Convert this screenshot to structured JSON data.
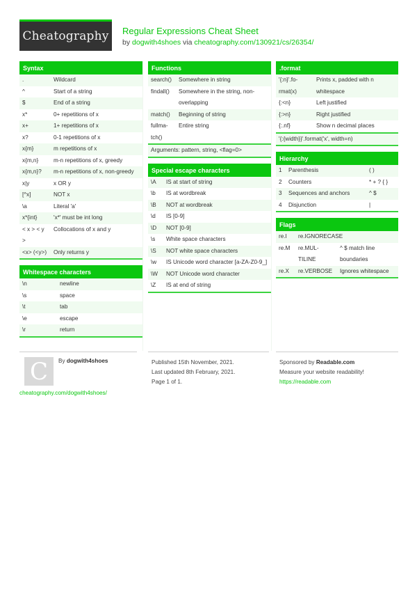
{
  "header": {
    "logo": "Cheatography",
    "title": "Regular Expressions Cheat Sheet",
    "by_prefix": "by",
    "author": "dogwith4shoes",
    "via": "via",
    "url": "cheatography.com/130921/cs/26354/"
  },
  "syntax": {
    "title": "Syntax",
    "rows": [
      [
        ".",
        "Wildcard"
      ],
      [
        "^",
        "Start of a string"
      ],
      [
        "$",
        "End of a string"
      ],
      [
        "x*",
        "0+ repetitions of x"
      ],
      [
        "x+",
        "1+ repetitions of x"
      ],
      [
        "x?",
        "0-1 repetitions of x"
      ],
      [
        "x{m}",
        "m repetitions of x"
      ],
      [
        "x{m,n}",
        "m-n repetitions of x, greedy"
      ],
      [
        "x{m,n}?",
        "m-n repetitions of x, non-greedy"
      ],
      [
        "x|y",
        "x OR y"
      ],
      [
        "[^x]",
        "NOT x"
      ],
      [
        "\\a",
        "Literal 'a'"
      ],
      [
        "x*{int}",
        "'x*' must be int long"
      ],
      [
        "< x > < y >",
        "Collocations of x and y"
      ],
      [
        "<x> (<y>)",
        "Only returns y"
      ]
    ]
  },
  "whitespace": {
    "title": "Whitespace characters",
    "rows": [
      [
        "\\n",
        "newline"
      ],
      [
        "\\s",
        "space"
      ],
      [
        "\\t",
        "tab"
      ],
      [
        "\\e",
        "escape"
      ],
      [
        "\\r",
        "return"
      ]
    ]
  },
  "functions": {
    "title": "Functions",
    "rows": [
      [
        "search()",
        "Somewhere in string"
      ],
      [
        "findall()",
        "Somewhere in the string, non-overlapping"
      ],
      [
        "match()",
        "Beginning of string"
      ],
      [
        "fullma-tch()",
        "Entire string"
      ]
    ],
    "note": "Arguments: pattern, string, <flag=0>"
  },
  "escape": {
    "title": "Special escape characters",
    "rows": [
      [
        "\\A",
        "IS at start of string"
      ],
      [
        "\\b",
        "IS at wordbreak"
      ],
      [
        "\\B",
        "NOT at wordbreak"
      ],
      [
        "\\d",
        "IS [0-9]"
      ],
      [
        "\\D",
        "NOT [0-9]"
      ],
      [
        "\\s",
        "White space characters"
      ],
      [
        "\\S",
        "NOT white space characters"
      ],
      [
        "\\w",
        "IS Unicode word character [a-ZA-Z0-9_]"
      ],
      [
        "\\W",
        "NOT Unicode word character"
      ],
      [
        "\\Z",
        "IS at end of string"
      ]
    ]
  },
  "format": {
    "title": ".format",
    "rows": [
      [
        "'{:n}'.fo-rmat(x)",
        "Prints x, padded with n whitespace"
      ],
      [
        "{:<n}",
        "Left justified"
      ],
      [
        "{:>n}",
        "Right justified"
      ],
      [
        "{:.nf}",
        "Show n decimal places"
      ]
    ],
    "note": "'{:{width}}'.format('x', width=n)"
  },
  "hierarchy": {
    "title": "Hierarchy",
    "rows": [
      [
        "1",
        "Parenthesis",
        "( )"
      ],
      [
        "2",
        "Counters",
        "* + ? { }"
      ],
      [
        "3",
        "Sequences and anchors",
        "^ $"
      ],
      [
        "4",
        "Disjunction",
        "|"
      ]
    ]
  },
  "flags": {
    "title": "Flags",
    "rows": [
      [
        "re.I",
        "re.IGNORECASE",
        ""
      ],
      [
        "re.M",
        "re.MUL-TILINE",
        "^ $ match line boundaries"
      ],
      [
        "re.X",
        "re.VERBOSE",
        "Ignores whitespace"
      ]
    ]
  },
  "footer": {
    "avatar_letter": "C",
    "by": "By",
    "author": "dogwith4shoes",
    "author_url": "cheatography.com/dogwith4shoes/",
    "published": "Published 15th November, 2021.",
    "updated": "Last updated 8th February, 2021.",
    "page": "Page 1 of 1.",
    "sponsored_prefix": "Sponsored by",
    "sponsor": "Readable.com",
    "sponsor_tagline": "Measure your website readability!",
    "sponsor_url": "https://readable.com"
  }
}
